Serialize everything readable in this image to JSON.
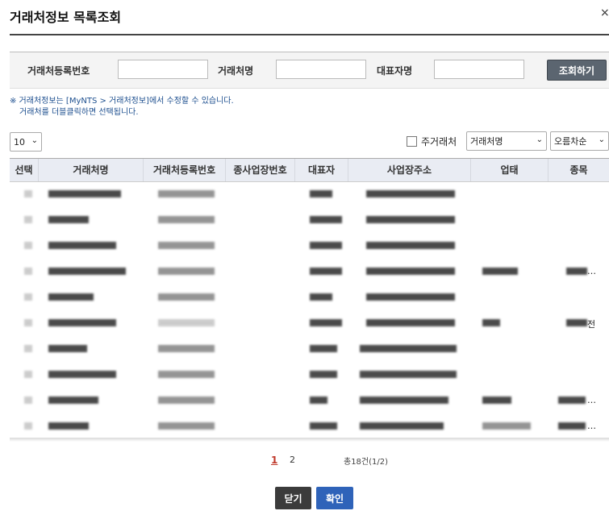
{
  "dialog": {
    "title": "거래처정보 목록조회",
    "close_glyph": "×"
  },
  "search": {
    "reg_no_label": "거래처등록번호",
    "name_label": "거래처명",
    "ceo_label": "대표자명",
    "reg_no_value": "",
    "name_value": "",
    "ceo_value": "",
    "button_label": "조회하기"
  },
  "notice": {
    "line1": "※ 거래처정보는 [MyNTS > 거래처정보]에서 수정할 수 있습니다.",
    "line2": "거래처를 더블클릭하면 선택됩니다."
  },
  "controls": {
    "page_size": "10",
    "main_partner_label": "주거래처",
    "sort_field": "거래처명",
    "sort_order": "오름차순"
  },
  "table": {
    "columns": [
      "선택",
      "거래처명",
      "거래처등록번호",
      "종사업장번호",
      "대표자",
      "사업장주소",
      "업태",
      "종목"
    ],
    "row_count": 10,
    "visible_fragments": {
      "row4_item": "…",
      "row6_item": "전",
      "row9_item": "…",
      "row10_item": "…"
    }
  },
  "pager": {
    "pages": [
      "1",
      "2"
    ],
    "current": "1",
    "info": "총18건(1/2)"
  },
  "footer": {
    "close_label": "닫기",
    "confirm_label": "확인"
  }
}
